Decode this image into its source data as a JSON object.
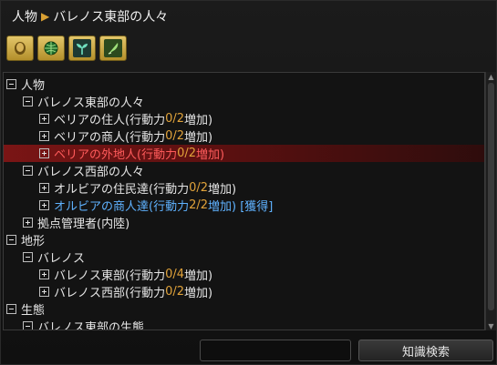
{
  "title": {
    "root": "人物",
    "current": "バレノス東部の人々"
  },
  "toolbar": {
    "buttons": [
      {
        "icon": "person-icon"
      },
      {
        "icon": "globe-icon"
      },
      {
        "icon": "sprout-icon"
      },
      {
        "icon": "quill-icon"
      }
    ]
  },
  "tree": [
    {
      "label": "人物",
      "toggle": "minus"
    },
    {
      "label": "バレノス東部の人々",
      "toggle": "minus"
    },
    {
      "pre": "ベリアの住人(行動力 ",
      "value": "0/2",
      "post": " 増加)",
      "toggle": "plus"
    },
    {
      "pre": "ベリアの商人(行動力 ",
      "value": "0/2",
      "post": " 増加)",
      "toggle": "plus"
    },
    {
      "pre": "ベリアの外地人(行動力 ",
      "value": "0/2",
      "post": " 増加)",
      "toggle": "plus"
    },
    {
      "label": "バレノス西部の人々",
      "toggle": "minus"
    },
    {
      "pre": "オルビアの住民達(行動力 ",
      "value": "0/2",
      "post": " 増加)",
      "toggle": "plus"
    },
    {
      "pre": "オルビアの商人達(行動力 ",
      "value": "2/2",
      "post": " 増加) [獲得]",
      "toggle": "plus"
    },
    {
      "label": "拠点管理者(内陸)",
      "toggle": "plus"
    },
    {
      "label": "地形",
      "toggle": "minus"
    },
    {
      "label": "バレノス",
      "toggle": "minus"
    },
    {
      "pre": "バレノス東部(行動力 ",
      "value": "0/4",
      "post": " 増加)",
      "toggle": "plus"
    },
    {
      "pre": "バレノス西部(行動力 ",
      "value": "0/2",
      "post": " 増加)",
      "toggle": "plus"
    },
    {
      "label": "生態",
      "toggle": "minus"
    },
    {
      "label": "バレノス東部の生態",
      "toggle": "minus"
    }
  ],
  "search": {
    "value": "",
    "button_label": "知識検索"
  },
  "colors": {
    "accent_orange": "#e0a23a",
    "acquired_blue": "#5fb2ff",
    "selected_red": "#ff5b5b"
  }
}
